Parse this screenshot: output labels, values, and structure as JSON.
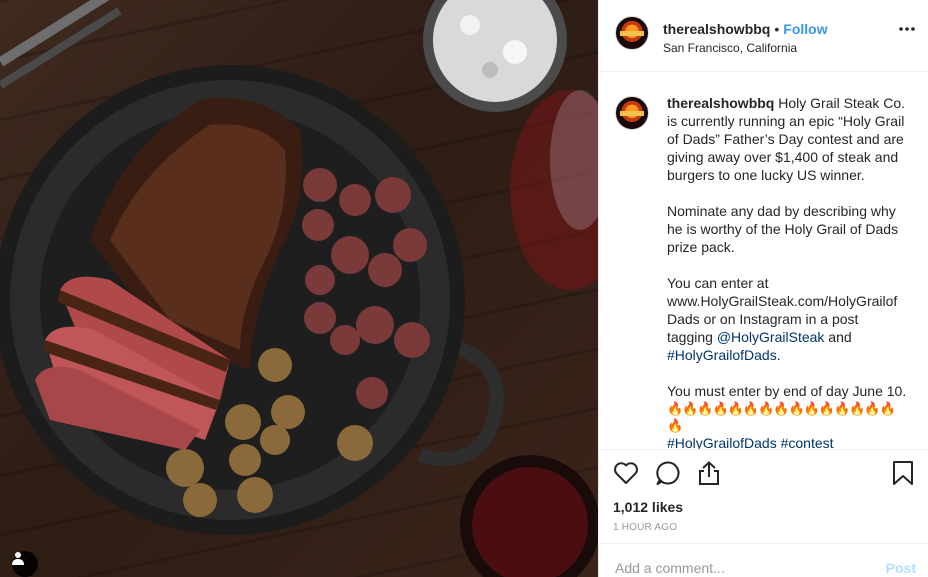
{
  "header": {
    "username": "therealshowbbq",
    "separator": "•",
    "follow_label": "Follow",
    "location": "San Francisco, California",
    "more_icon": "ellipsis-icon"
  },
  "caption": {
    "username": "therealshowbbq",
    "paragraph1": "Holy Grail Steak Co. is currently running an epic “Holy Grail of Dads” Father’s Day contest and are giving away over $1,400 of steak and burgers to one lucky US winner.",
    "paragraph2": "Nominate any dad by describing why he is worthy of the Holy Grail of Dads prize pack.",
    "paragraph3_pre": "You can enter at www.HolyGrailSteak.com/HolyGrailofDads or on Instagram in a post tagging ",
    "mention": "@HolyGrailSteak",
    "paragraph3_mid": " and ",
    "hashtag": "#HolyGrailofDads",
    "paragraph3_end": ".",
    "paragraph4": "You must enter by end of day June 10.",
    "flames": "🔥🔥🔥🔥🔥🔥🔥🔥🔥🔥🔥🔥🔥🔥🔥🔥",
    "partial_hashtags": "#HolyGrailofDads #contest"
  },
  "actions": {
    "like_icon": "heart-icon",
    "comment_icon": "comment-icon",
    "share_icon": "share-icon",
    "save_icon": "bookmark-icon",
    "likes": "1,012 likes",
    "time": "1 HOUR AGO"
  },
  "comment_box": {
    "placeholder": "Add a comment...",
    "post_label": "Post"
  },
  "colors": {
    "accent": "#3897f0",
    "link": "#003569",
    "border": "#efefef",
    "muted": "#999999"
  }
}
